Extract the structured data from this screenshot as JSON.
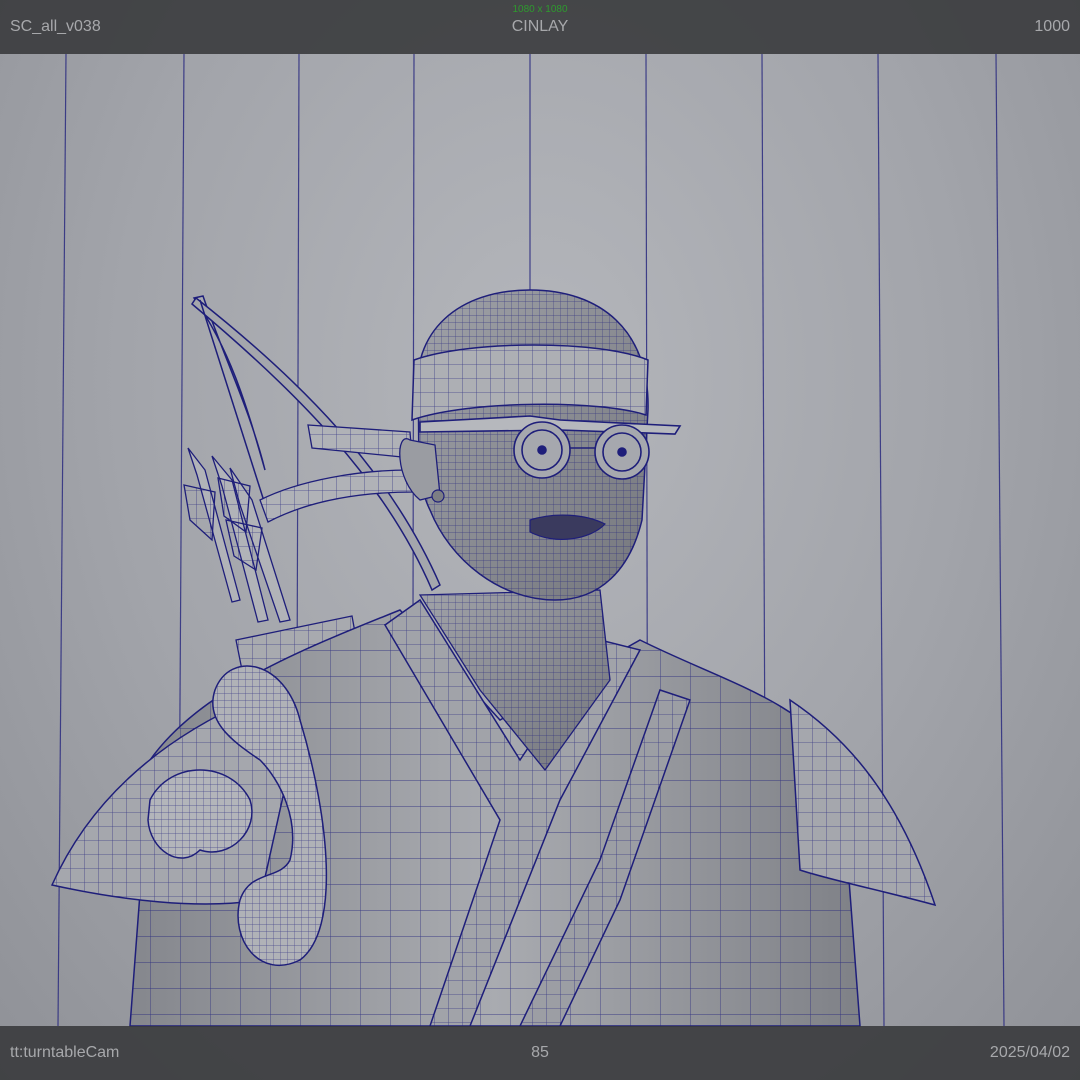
{
  "hud": {
    "top_left": "SC_all_v038",
    "top_center": "CINLAY",
    "top_right": "1000",
    "resolution_gate": "1080 x 1080",
    "bottom_left": "tt:turntableCam",
    "bottom_center": "85",
    "bottom_right": "2025/04/02"
  },
  "viewport": {
    "display_mode": "wireframe-on-shaded",
    "wire_color": "#1e1e7a",
    "background_color": "#a3a5ab",
    "icons": [
      "character-mesh",
      "bow",
      "quiver",
      "arrows",
      "glasses",
      "headband",
      "robe",
      "shoulder-armor"
    ]
  }
}
